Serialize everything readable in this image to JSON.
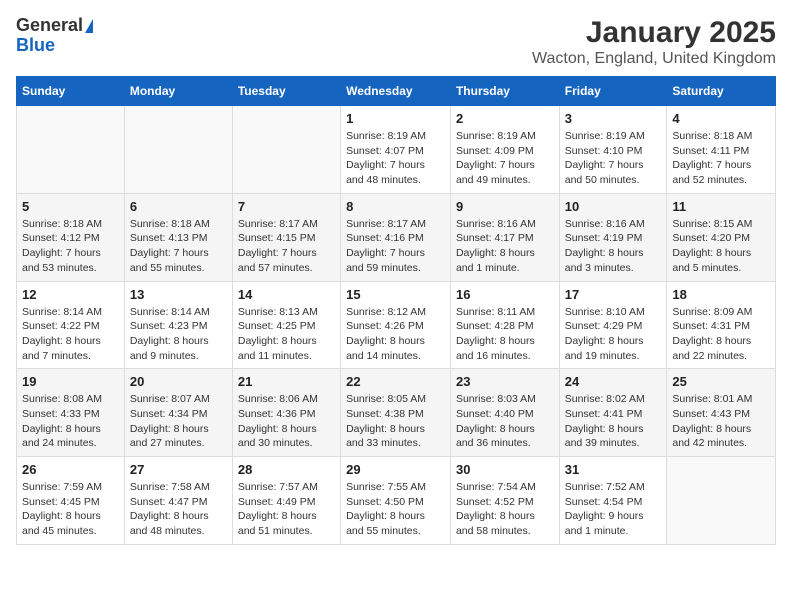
{
  "app": {
    "logo_line1": "General",
    "logo_line2": "Blue",
    "title": "January 2025",
    "subtitle": "Wacton, England, United Kingdom"
  },
  "calendar": {
    "headers": [
      "Sunday",
      "Monday",
      "Tuesday",
      "Wednesday",
      "Thursday",
      "Friday",
      "Saturday"
    ],
    "weeks": [
      [
        {
          "day": "",
          "info": ""
        },
        {
          "day": "",
          "info": ""
        },
        {
          "day": "",
          "info": ""
        },
        {
          "day": "1",
          "info": "Sunrise: 8:19 AM\nSunset: 4:07 PM\nDaylight: 7 hours\nand 48 minutes."
        },
        {
          "day": "2",
          "info": "Sunrise: 8:19 AM\nSunset: 4:09 PM\nDaylight: 7 hours\nand 49 minutes."
        },
        {
          "day": "3",
          "info": "Sunrise: 8:19 AM\nSunset: 4:10 PM\nDaylight: 7 hours\nand 50 minutes."
        },
        {
          "day": "4",
          "info": "Sunrise: 8:18 AM\nSunset: 4:11 PM\nDaylight: 7 hours\nand 52 minutes."
        }
      ],
      [
        {
          "day": "5",
          "info": "Sunrise: 8:18 AM\nSunset: 4:12 PM\nDaylight: 7 hours\nand 53 minutes."
        },
        {
          "day": "6",
          "info": "Sunrise: 8:18 AM\nSunset: 4:13 PM\nDaylight: 7 hours\nand 55 minutes."
        },
        {
          "day": "7",
          "info": "Sunrise: 8:17 AM\nSunset: 4:15 PM\nDaylight: 7 hours\nand 57 minutes."
        },
        {
          "day": "8",
          "info": "Sunrise: 8:17 AM\nSunset: 4:16 PM\nDaylight: 7 hours\nand 59 minutes."
        },
        {
          "day": "9",
          "info": "Sunrise: 8:16 AM\nSunset: 4:17 PM\nDaylight: 8 hours\nand 1 minute."
        },
        {
          "day": "10",
          "info": "Sunrise: 8:16 AM\nSunset: 4:19 PM\nDaylight: 8 hours\nand 3 minutes."
        },
        {
          "day": "11",
          "info": "Sunrise: 8:15 AM\nSunset: 4:20 PM\nDaylight: 8 hours\nand 5 minutes."
        }
      ],
      [
        {
          "day": "12",
          "info": "Sunrise: 8:14 AM\nSunset: 4:22 PM\nDaylight: 8 hours\nand 7 minutes."
        },
        {
          "day": "13",
          "info": "Sunrise: 8:14 AM\nSunset: 4:23 PM\nDaylight: 8 hours\nand 9 minutes."
        },
        {
          "day": "14",
          "info": "Sunrise: 8:13 AM\nSunset: 4:25 PM\nDaylight: 8 hours\nand 11 minutes."
        },
        {
          "day": "15",
          "info": "Sunrise: 8:12 AM\nSunset: 4:26 PM\nDaylight: 8 hours\nand 14 minutes."
        },
        {
          "day": "16",
          "info": "Sunrise: 8:11 AM\nSunset: 4:28 PM\nDaylight: 8 hours\nand 16 minutes."
        },
        {
          "day": "17",
          "info": "Sunrise: 8:10 AM\nSunset: 4:29 PM\nDaylight: 8 hours\nand 19 minutes."
        },
        {
          "day": "18",
          "info": "Sunrise: 8:09 AM\nSunset: 4:31 PM\nDaylight: 8 hours\nand 22 minutes."
        }
      ],
      [
        {
          "day": "19",
          "info": "Sunrise: 8:08 AM\nSunset: 4:33 PM\nDaylight: 8 hours\nand 24 minutes."
        },
        {
          "day": "20",
          "info": "Sunrise: 8:07 AM\nSunset: 4:34 PM\nDaylight: 8 hours\nand 27 minutes."
        },
        {
          "day": "21",
          "info": "Sunrise: 8:06 AM\nSunset: 4:36 PM\nDaylight: 8 hours\nand 30 minutes."
        },
        {
          "day": "22",
          "info": "Sunrise: 8:05 AM\nSunset: 4:38 PM\nDaylight: 8 hours\nand 33 minutes."
        },
        {
          "day": "23",
          "info": "Sunrise: 8:03 AM\nSunset: 4:40 PM\nDaylight: 8 hours\nand 36 minutes."
        },
        {
          "day": "24",
          "info": "Sunrise: 8:02 AM\nSunset: 4:41 PM\nDaylight: 8 hours\nand 39 minutes."
        },
        {
          "day": "25",
          "info": "Sunrise: 8:01 AM\nSunset: 4:43 PM\nDaylight: 8 hours\nand 42 minutes."
        }
      ],
      [
        {
          "day": "26",
          "info": "Sunrise: 7:59 AM\nSunset: 4:45 PM\nDaylight: 8 hours\nand 45 minutes."
        },
        {
          "day": "27",
          "info": "Sunrise: 7:58 AM\nSunset: 4:47 PM\nDaylight: 8 hours\nand 48 minutes."
        },
        {
          "day": "28",
          "info": "Sunrise: 7:57 AM\nSunset: 4:49 PM\nDaylight: 8 hours\nand 51 minutes."
        },
        {
          "day": "29",
          "info": "Sunrise: 7:55 AM\nSunset: 4:50 PM\nDaylight: 8 hours\nand 55 minutes."
        },
        {
          "day": "30",
          "info": "Sunrise: 7:54 AM\nSunset: 4:52 PM\nDaylight: 8 hours\nand 58 minutes."
        },
        {
          "day": "31",
          "info": "Sunrise: 7:52 AM\nSunset: 4:54 PM\nDaylight: 9 hours\nand 1 minute."
        },
        {
          "day": "",
          "info": ""
        }
      ]
    ]
  }
}
